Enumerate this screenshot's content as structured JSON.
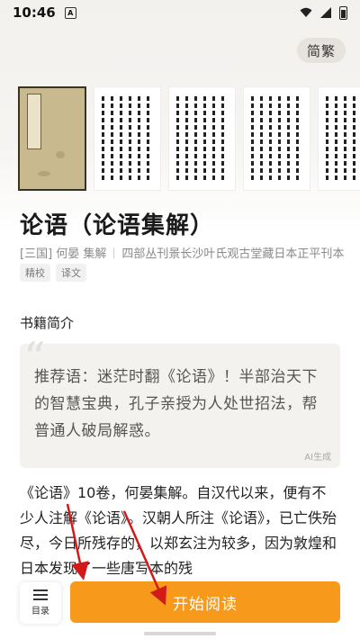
{
  "status_bar": {
    "time": "10:46",
    "notification_glyph": "A"
  },
  "header": {
    "lang_toggle_label": "简繁"
  },
  "book": {
    "title": "论语（论语集解）",
    "author": "[三国] 何晏 集解",
    "edition": "四部丛刊景长沙叶氏观古堂藏日本正平刊本",
    "tags": [
      "精校",
      "译文"
    ]
  },
  "intro": {
    "section_title": "书籍简介",
    "recommendation": "推荐语：迷茫时翻《论语》！半部治天下的智慧宝典，孔子亲授为人处世招法，帮普通人破局解惑。",
    "ai_label": "AI生成",
    "description": "《论语》10卷，何晏集解。自汉代以来，便有不少人注解《论语》。汉朝人所注《论语》，已亡佚殆尽，今日所残存的，以郑玄注为较多，因为敦煌和日本发现了一些唐写本的残"
  },
  "bottom_bar": {
    "toc_label": "目录",
    "read_button_label": "开始阅读"
  },
  "colors": {
    "accent": "#f79a1c",
    "annotation_arrow": "#d11a1a"
  },
  "icons": [
    "notification-icon",
    "wifi-icon",
    "signal-icon",
    "battery-icon",
    "hamburger-icon",
    "quote-icon"
  ]
}
